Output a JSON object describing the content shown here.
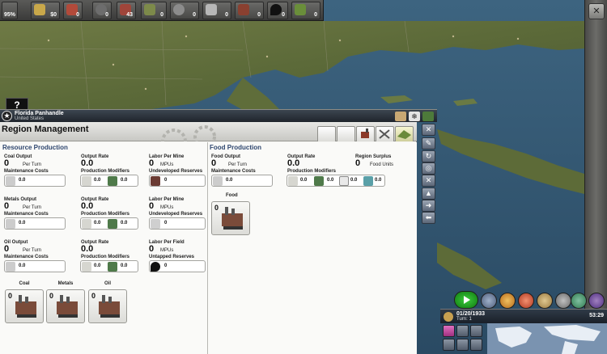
{
  "topbar": {
    "approval": "95%",
    "cells": [
      {
        "icon": "money-icon",
        "value": "$0"
      },
      {
        "icon": "flag-icon",
        "value": "0"
      },
      {
        "icon": "gear-icon",
        "value": "0"
      },
      {
        "icon": "industry-icon",
        "value": "43"
      },
      {
        "icon": "food-icon",
        "value": "0"
      },
      {
        "icon": "gears-icon",
        "value": "0"
      },
      {
        "icon": "steel-icon",
        "value": "0"
      },
      {
        "icon": "goods-icon",
        "value": "0"
      },
      {
        "icon": "oil-icon",
        "value": "0"
      },
      {
        "icon": "plant-icon",
        "value": "0"
      }
    ]
  },
  "help_label": "?",
  "region": {
    "name": "Florida Panhandle",
    "country": "United States"
  },
  "panel": {
    "title": "Region Management",
    "resource": {
      "section_title": "Resource Production",
      "rows": [
        {
          "output_label": "Coal Output",
          "output_value": "0",
          "per_turn": "Per Turn",
          "maint_label": "Maintenance Costs",
          "maint_value": "0.0",
          "rate_label": "Output Rate",
          "rate_value": "0.0",
          "mod_label": "Production Modifiers",
          "mod_a": "0.0",
          "mod_b": "0.0",
          "labor_label": "Labor Per Mine",
          "labor_value": "0",
          "labor_unit": "MPUs",
          "reserve_label": "Undeveloped Reserves",
          "reserve_value": "0"
        },
        {
          "output_label": "Metals Output",
          "output_value": "0",
          "per_turn": "Per Turn",
          "maint_label": "Maintenance Costs",
          "maint_value": "0.0",
          "rate_label": "Output Rate",
          "rate_value": "0.0",
          "mod_label": "Production Modifiers",
          "mod_a": "0.0",
          "mod_b": "0.0",
          "labor_label": "Labor Per Mine",
          "labor_value": "0",
          "labor_unit": "MPUs",
          "reserve_label": "Undeveloped Reserves",
          "reserve_value": "0"
        },
        {
          "output_label": "Oil Output",
          "output_value": "0",
          "per_turn": "Per Turn",
          "maint_label": "Maintenance Costs",
          "maint_value": "0.0",
          "rate_label": "Output Rate",
          "rate_value": "0.0",
          "mod_label": "Production Modifiers",
          "mod_a": "0.0",
          "mod_b": "0.0",
          "labor_label": "Labor Per Field",
          "labor_value": "0",
          "labor_unit": "MPUs",
          "reserve_label": "Untapped Reserves",
          "reserve_value": "0"
        }
      ],
      "facilities": [
        {
          "label": "Coal",
          "count": "0"
        },
        {
          "label": "Metals",
          "count": "0"
        },
        {
          "label": "Oil",
          "count": "0"
        }
      ]
    },
    "food": {
      "section_title": "Food Production",
      "output_label": "Food Output",
      "output_value": "0",
      "per_turn": "Per Turn",
      "maint_label": "Maintenance Costs",
      "maint_value": "0.0",
      "rate_label": "Output Rate",
      "rate_value": "0.0",
      "mod_label": "Production Modifiers",
      "mod_a": "0.0",
      "mod_b": "0.0",
      "mod_c": "0.0",
      "mod_d": "0.0",
      "surplus_label": "Region Surplus",
      "surplus_value": "0",
      "surplus_unit": "Food Units",
      "facility": {
        "label": "Food",
        "count": "0"
      }
    }
  },
  "clock": {
    "date": "01/20/1933",
    "turn": "Turn: 1",
    "time": "53:29"
  }
}
